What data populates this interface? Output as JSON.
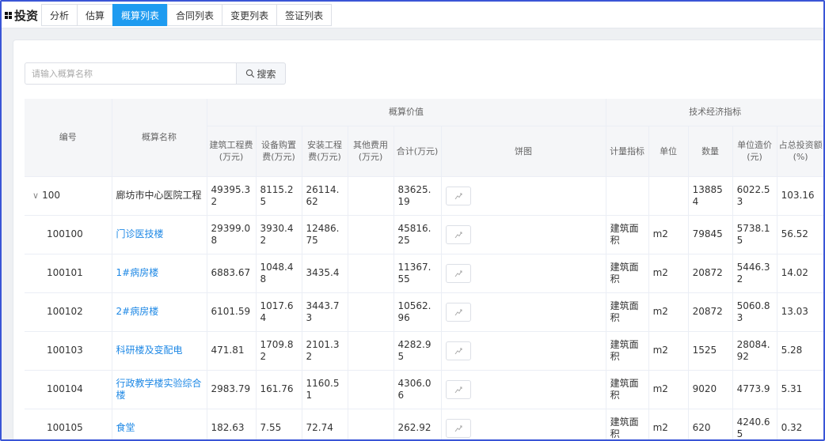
{
  "header": {
    "brand": "投资",
    "tabs": [
      {
        "label": "分析",
        "active": false
      },
      {
        "label": "估算",
        "active": false
      },
      {
        "label": "概算列表",
        "active": true
      },
      {
        "label": "合同列表",
        "active": false
      },
      {
        "label": "变更列表",
        "active": false
      },
      {
        "label": "签证列表",
        "active": false
      }
    ]
  },
  "search": {
    "placeholder": "请输入概算名称",
    "button_label": "搜索"
  },
  "colors": {
    "accent": "#1e9bf0",
    "link": "#1e88e5",
    "frame": "#3a55d6"
  },
  "table": {
    "headers": {
      "code": "编号",
      "name": "概算名称",
      "group_value": "概算价值",
      "construction": "建筑工程费(万元)",
      "equipment": "设备购置费(万元)",
      "install": "安装工程费(万元)",
      "other": "其他费用(万元)",
      "total": "合计(万元)",
      "pie": "饼图",
      "group_tech": "技术经济指标",
      "metric": "计量指标",
      "unit": "单位",
      "quantity": "数量",
      "unit_price": "单位造价(元)",
      "ratio": "占总投资额(%)"
    },
    "rows": [
      {
        "code": "100",
        "expand": "∨",
        "name": "廊坊市中心医院工程",
        "link": false,
        "construction": "49395.32",
        "equipment": "8115.25",
        "install": "26114.62",
        "other": "",
        "total": "83625.19",
        "metric": "",
        "unit": "",
        "quantity": "138854",
        "unit_price": "6022.53",
        "ratio": "103.16"
      },
      {
        "code": "100100",
        "name": "门诊医技楼",
        "link": true,
        "construction": "29399.08",
        "equipment": "3930.42",
        "install": "12486.75",
        "other": "",
        "total": "45816.25",
        "metric": "建筑面积",
        "unit": "m2",
        "quantity": "79845",
        "unit_price": "5738.15",
        "ratio": "56.52"
      },
      {
        "code": "100101",
        "name": "1#病房楼",
        "link": true,
        "construction": "6883.67",
        "equipment": "1048.48",
        "install": "3435.4",
        "other": "",
        "total": "11367.55",
        "metric": "建筑面积",
        "unit": "m2",
        "quantity": "20872",
        "unit_price": "5446.32",
        "ratio": "14.02"
      },
      {
        "code": "100102",
        "name": "2#病房楼",
        "link": true,
        "construction": "6101.59",
        "equipment": "1017.64",
        "install": "3443.73",
        "other": "",
        "total": "10562.96",
        "metric": "建筑面积",
        "unit": "m2",
        "quantity": "20872",
        "unit_price": "5060.83",
        "ratio": "13.03"
      },
      {
        "code": "100103",
        "name": "科研楼及变配电",
        "link": true,
        "construction": "471.81",
        "equipment": "1709.82",
        "install": "2101.32",
        "other": "",
        "total": "4282.95",
        "metric": "建筑面积",
        "unit": "m2",
        "quantity": "1525",
        "unit_price": "28084.92",
        "ratio": "5.28"
      },
      {
        "code": "100104",
        "name": "行政教学楼实验综合楼",
        "link": true,
        "construction": "2983.79",
        "equipment": "161.76",
        "install": "1160.51",
        "other": "",
        "total": "4306.06",
        "metric": "建筑面积",
        "unit": "m2",
        "quantity": "9020",
        "unit_price": "4773.9",
        "ratio": "5.31"
      },
      {
        "code": "100105",
        "name": "食堂",
        "link": true,
        "construction": "182.63",
        "equipment": "7.55",
        "install": "72.74",
        "other": "",
        "total": "262.92",
        "metric": "建筑面积",
        "unit": "m2",
        "quantity": "620",
        "unit_price": "4240.65",
        "ratio": "0.32"
      }
    ]
  }
}
